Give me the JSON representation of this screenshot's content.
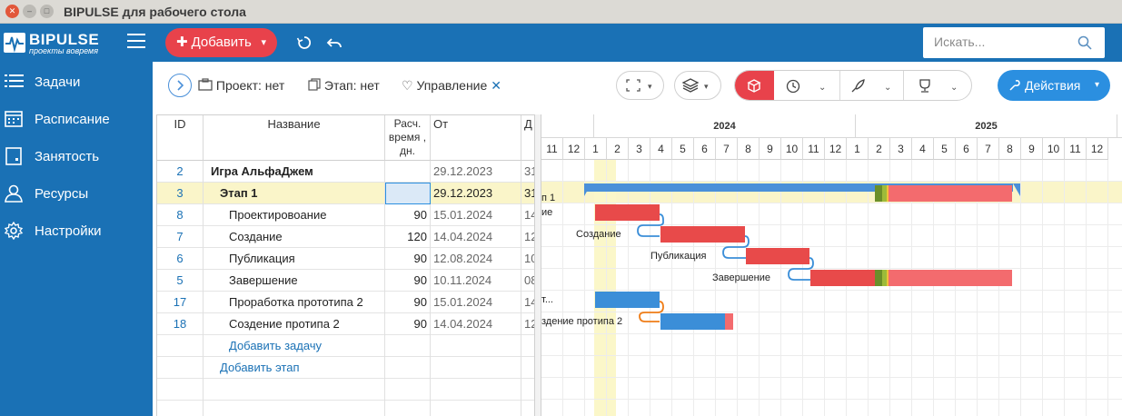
{
  "window": {
    "title": "BIPULSE для рабочего стола"
  },
  "brand": {
    "name": "BIPULSE",
    "tagline": "проекты вовремя"
  },
  "topbar": {
    "add_label": "Добавить",
    "search_placeholder": "Искать..."
  },
  "sidebar": {
    "items": [
      {
        "label": "Задачи",
        "icon": "list-icon"
      },
      {
        "label": "Расписание",
        "icon": "calendar-icon"
      },
      {
        "label": "Занятость",
        "icon": "clipboard-icon"
      },
      {
        "label": "Ресурсы",
        "icon": "user-icon"
      },
      {
        "label": "Настройки",
        "icon": "gear-icon"
      }
    ]
  },
  "toolbar": {
    "project_label": "Проект: нет",
    "stage_label": "Этап: нет",
    "management_label": "Управление",
    "actions_label": "Действия"
  },
  "grid": {
    "headers": {
      "id": "ID",
      "name": "Название",
      "est": "Расч. время , дн.",
      "from": "От",
      "to": "Д"
    },
    "rows": [
      {
        "id": "2",
        "name": "Игра АльфаДжем",
        "est": "",
        "from": "29.12.2023",
        "to": "31",
        "level": 0,
        "bold": true
      },
      {
        "id": "3",
        "name": "Этап 1",
        "est": "",
        "from": "29.12.2023",
        "to": "31",
        "level": 1,
        "bold": true,
        "selected": true
      },
      {
        "id": "8",
        "name": "Проектировоание",
        "est": "90",
        "from": "15.01.2024",
        "to": "14",
        "level": 2
      },
      {
        "id": "7",
        "name": "Создание",
        "est": "120",
        "from": "14.04.2024",
        "to": "12",
        "level": 2
      },
      {
        "id": "6",
        "name": "Публикация",
        "est": "90",
        "from": "12.08.2024",
        "to": "10",
        "level": 2
      },
      {
        "id": "5",
        "name": "Завершение",
        "est": "90",
        "from": "10.11.2024",
        "to": "08",
        "level": 2
      },
      {
        "id": "17",
        "name": "Проработка прототипа 2",
        "est": "90",
        "from": "15.01.2024",
        "to": "14",
        "level": 2
      },
      {
        "id": "18",
        "name": "Создение протипа 2",
        "est": "90",
        "from": "14.04.2024",
        "to": "12",
        "level": 2
      }
    ],
    "add_task": "Добавить задачу",
    "add_stage": "Добавить этап"
  },
  "gantt": {
    "years": [
      {
        "label": ""
      },
      {
        "label": "2024"
      },
      {
        "label": "2025"
      },
      {
        "label": ""
      }
    ],
    "months": [
      "11",
      "12",
      "1",
      "2",
      "3",
      "4",
      "5",
      "6",
      "7",
      "8",
      "9",
      "10",
      "11",
      "12",
      "1",
      "2",
      "3",
      "4",
      "5",
      "6",
      "7",
      "8",
      "9",
      "10",
      "11",
      "12"
    ],
    "labels": {
      "stage": "п 1",
      "design": "ие",
      "create": "Создание",
      "publish": "Публикация",
      "finish": "Завершение",
      "proto": "т...",
      "proto2": "здение протипа 2"
    },
    "colors": {
      "planned": "#e84a4a",
      "overdue": "#f36b6e",
      "done": "#3b8ed8",
      "stage": "#4a90d9",
      "progress": "#6a8f2a",
      "today": "#fbf7c9"
    }
  }
}
